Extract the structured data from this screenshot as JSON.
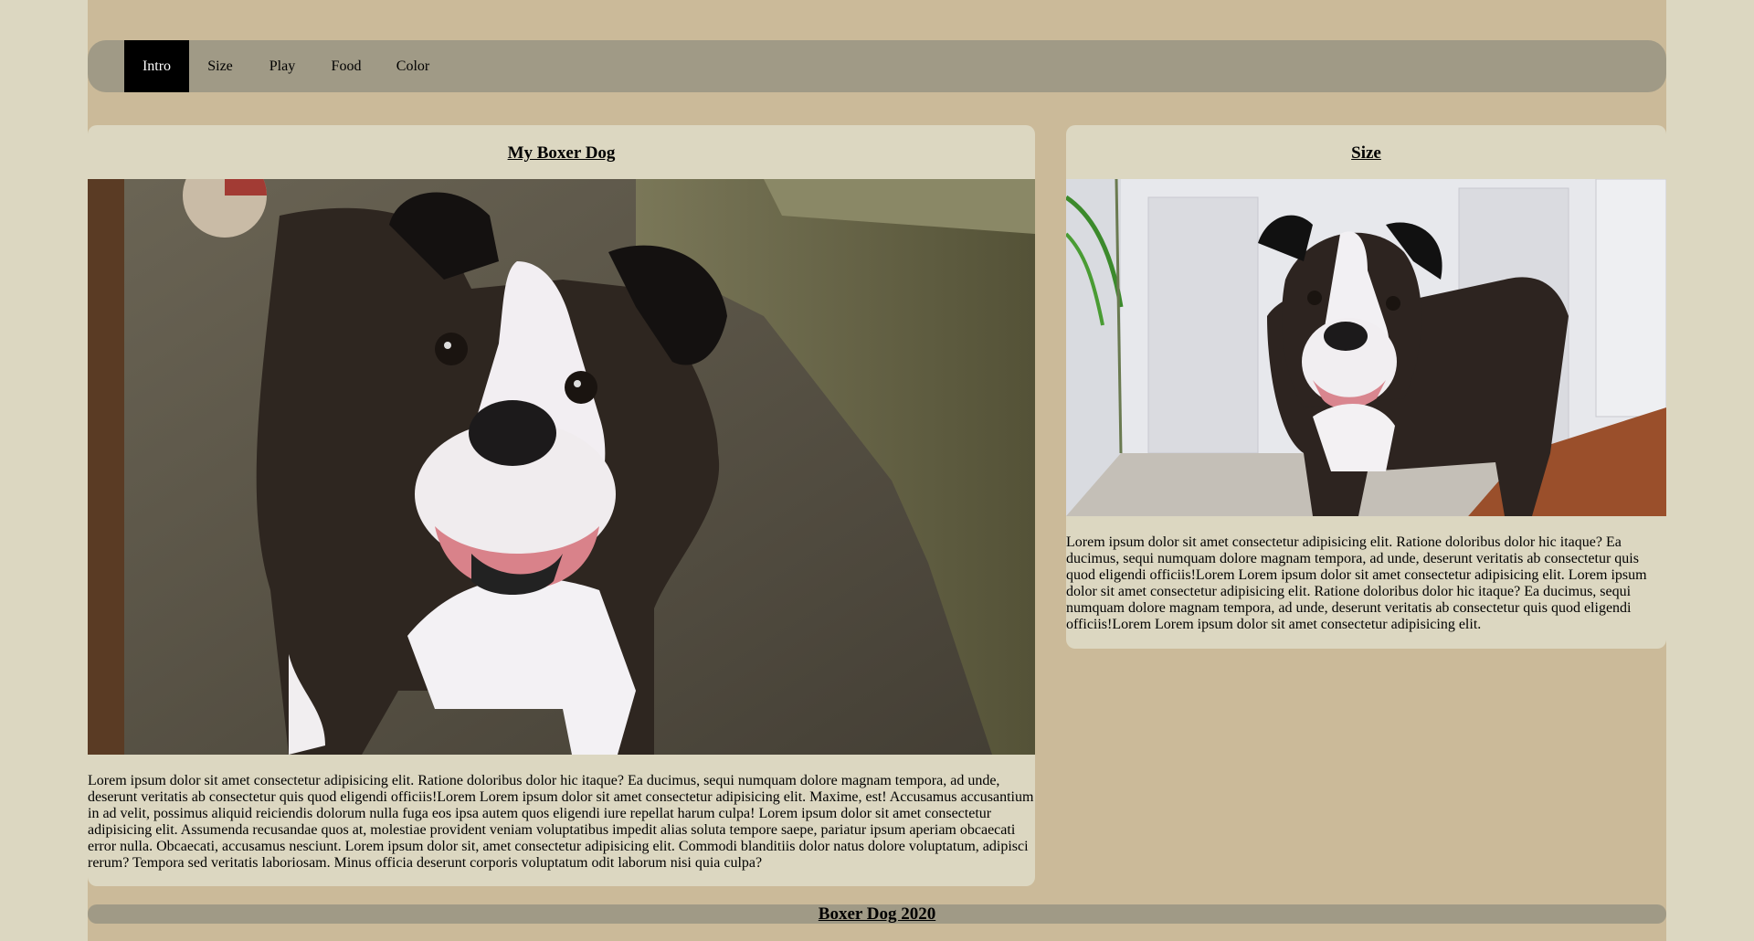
{
  "nav": {
    "items": [
      {
        "label": "Intro",
        "active": true
      },
      {
        "label": "Size",
        "active": false
      },
      {
        "label": "Play",
        "active": false
      },
      {
        "label": "Food",
        "active": false
      },
      {
        "label": "Color",
        "active": false
      }
    ]
  },
  "main_card": {
    "title": "My Boxer Dog",
    "photo_icon": "boxer-dog-photo",
    "text": "Lorem ipsum dolor sit amet consectetur adipisicing elit. Ratione doloribus dolor hic itaque? Ea ducimus, sequi numquam dolore magnam tempora, ad unde, deserunt veritatis ab consectetur quis quod eligendi officiis!Lorem Lorem ipsum dolor sit amet consectetur adipisicing elit. Maxime, est! Accusamus accusantium in ad velit, possimus aliquid reiciendis dolorum nulla fuga eos ipsa autem quos eligendi iure repellat harum culpa! Lorem ipsum dolor sit amet consectetur adipisicing elit. Assumenda recusandae quos at, molestiae provident veniam voluptatibus impedit alias soluta tempore saepe, pariatur ipsum aperiam obcaecati error nulla. Obcaecati, accusamus nesciunt. Lorem ipsum dolor sit, amet consectetur adipisicing elit. Commodi blanditiis dolor natus dolore voluptatum, adipisci rerum? Tempora sed veritatis laboriosam. Minus officia deserunt corporis voluptatum odit laborum nisi quia culpa?"
  },
  "side_card": {
    "title": "Size",
    "photo_icon": "boxer-dog-photo",
    "text": "Lorem ipsum dolor sit amet consectetur adipisicing elit. Ratione doloribus dolor hic itaque? Ea ducimus, sequi numquam dolore magnam tempora, ad unde, deserunt veritatis ab consectetur quis quod eligendi officiis!Lorem Lorem ipsum dolor sit amet consectetur adipisicing elit. Lorem ipsum dolor sit amet consectetur adipisicing elit. Ratione doloribus dolor hic itaque? Ea ducimus, sequi numquam dolore magnam tempora, ad unde, deserunt veritatis ab consectetur quis quod eligendi officiis!Lorem Lorem ipsum dolor sit amet consectetur adipisicing elit."
  },
  "footer": {
    "text": "Boxer Dog 2020"
  },
  "colors": {
    "outer_background": "#dcd7c1",
    "page_background": "#cbba99",
    "nav_background": "#a09a86",
    "nav_active": "#000000",
    "card_background": "#dcd7c1"
  }
}
